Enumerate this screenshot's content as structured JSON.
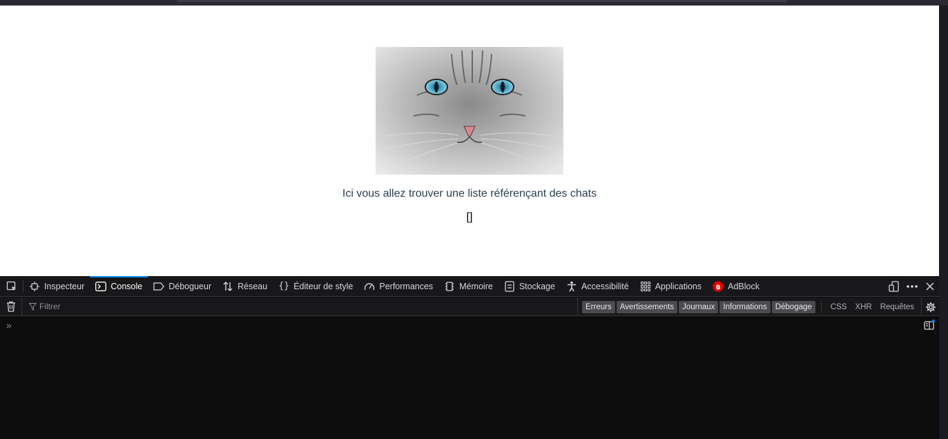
{
  "page": {
    "text": "Ici vous allez trouver une liste référençant des chats",
    "list_output": "[]",
    "image_name": "cat-photo"
  },
  "devtools": {
    "tabs": [
      {
        "label": "Inspecteur",
        "icon": "inspector-icon"
      },
      {
        "label": "Console",
        "icon": "console-icon",
        "active": true
      },
      {
        "label": "Débogueur",
        "icon": "debugger-icon"
      },
      {
        "label": "Réseau",
        "icon": "network-icon"
      },
      {
        "label": "Éditeur de style",
        "icon": "style-editor-icon"
      },
      {
        "label": "Performances",
        "icon": "performance-icon"
      },
      {
        "label": "Mémoire",
        "icon": "memory-icon"
      },
      {
        "label": "Stockage",
        "icon": "storage-icon"
      },
      {
        "label": "Accessibilité",
        "icon": "accessibility-icon"
      },
      {
        "label": "Applications",
        "icon": "applications-icon"
      },
      {
        "label": "AdBlock",
        "icon": "adblock-icon"
      }
    ],
    "filter_placeholder": "Filtrer",
    "level_filters": [
      "Erreurs",
      "Avertissements",
      "Journaux",
      "Informations",
      "Débogage"
    ],
    "type_filters": [
      "CSS",
      "XHR",
      "Requêtes"
    ],
    "prompt": "»",
    "colors": {
      "accent": "#0a84ff",
      "panel_bg": "#0c0c0d",
      "toolbar_bg": "#18181a",
      "adblock_red": "#e40000"
    }
  }
}
